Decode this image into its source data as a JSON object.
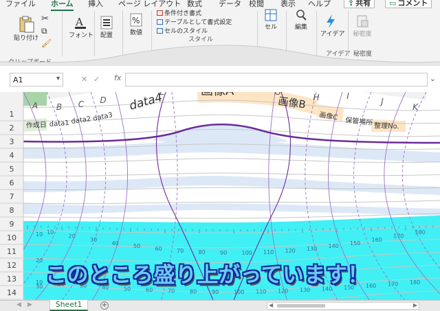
{
  "ribbon": {
    "tabs": [
      "ファイル",
      "ホーム",
      "挿入",
      "ページ レイアウト",
      "数式",
      "データ",
      "校閲",
      "表示",
      "ヘルプ"
    ],
    "active_tab": "ホーム",
    "share_label": "共有",
    "comment_label": "コメント",
    "paste_label": "貼り付け",
    "font_label": "フォント",
    "align_label": "配置",
    "number_label": "数値",
    "cond_format_label": "条件付き書式",
    "table_format_label": "テーブルとして書式設定",
    "cell_style_label": "セルのスタイル",
    "cells_label": "セル",
    "edit_label": "編集",
    "ideas_label": "アイデア",
    "sensitivity_label": "秘密度",
    "clipboard_group": "クリップボード",
    "style_group": "スタイル",
    "ideas_group": "アイデア",
    "sensitivity_group": "秘密度"
  },
  "formula_bar": {
    "name_box": "A1",
    "fx": "fx",
    "value": ""
  },
  "grid": {
    "columns": [
      "A",
      "B",
      "C",
      "D",
      "E",
      "F",
      "G",
      "H",
      "I",
      "J",
      "K"
    ],
    "rows": [
      "1",
      "2",
      "3",
      "4",
      "5",
      "6",
      "7",
      "8",
      "9",
      "10",
      "11",
      "12",
      "13",
      "14"
    ],
    "header_row1": {
      "E": "data4",
      "F": "画像A",
      "G": "画像B"
    },
    "header_row2": [
      "作成日",
      "data1",
      "data2",
      "data3",
      "画像C",
      "保管場所",
      "整理No."
    ],
    "ruler_top": [
      "10",
      "20",
      "30",
      "40",
      "50",
      "60",
      "70",
      "80",
      "90",
      "100",
      "110",
      "120",
      "130",
      "140",
      "150",
      "160",
      "170",
      "180"
    ],
    "ruler_bottom": [
      "10",
      "20",
      "30",
      "40",
      "50",
      "60",
      "70",
      "80",
      "90",
      "100",
      "110",
      "120",
      "130",
      "140",
      "150",
      "160",
      "170",
      "180"
    ],
    "ruler_left": [
      "10",
      "20",
      "30"
    ]
  },
  "headline": "このところ盛り上がっています！",
  "sheet_tabs": {
    "active": "Sheet1"
  },
  "colors": {
    "accent": "#217346",
    "headline_fill": "#6fc8f4",
    "headline_stroke": "#0b2a9c",
    "band_blue": "#dde8f7",
    "cyan": "#40f0f5",
    "purple_curve": "#6a2b9a",
    "orange_header": "#fde5c4"
  }
}
